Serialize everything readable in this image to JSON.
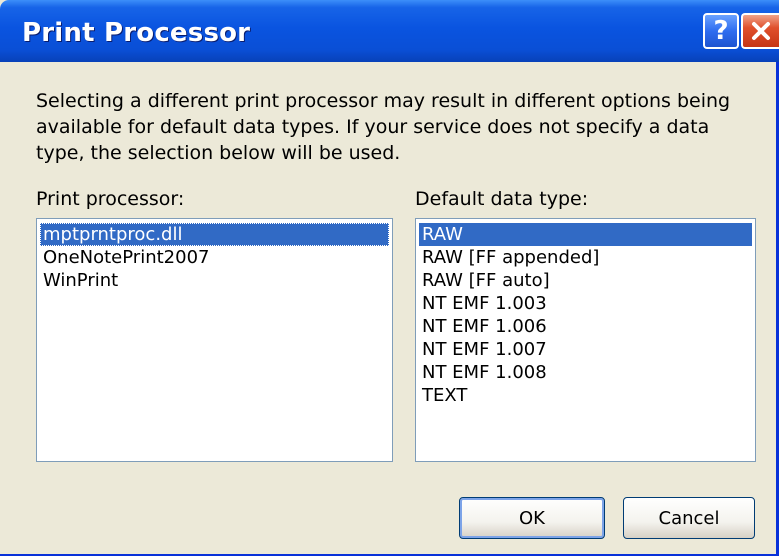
{
  "dialog": {
    "title": "Print Processor",
    "help_symbol": "?",
    "description_lines": [
      "Selecting a different print processor may result in different options being",
      "available for default data types. If your service does not specify a data",
      "type, the selection below will be used."
    ]
  },
  "processor_list": {
    "label": "Print processor:",
    "items": [
      "mptprntproc.dll",
      "OneNotePrint2007",
      "WinPrint"
    ],
    "selected": "mptprntproc.dll"
  },
  "datatype_list": {
    "label": "Default data type:",
    "items": [
      "RAW",
      "RAW [FF appended]",
      "RAW [FF auto]",
      "NT EMF 1.003",
      "NT EMF 1.006",
      "NT EMF 1.007",
      "NT EMF 1.008",
      "TEXT"
    ],
    "selected": "RAW"
  },
  "buttons": {
    "ok": "OK",
    "cancel": "Cancel"
  },
  "colors": {
    "titlebar": "#0a54e0",
    "selection": "#316ac5",
    "face": "#ece9d8",
    "close": "#e0502c"
  }
}
